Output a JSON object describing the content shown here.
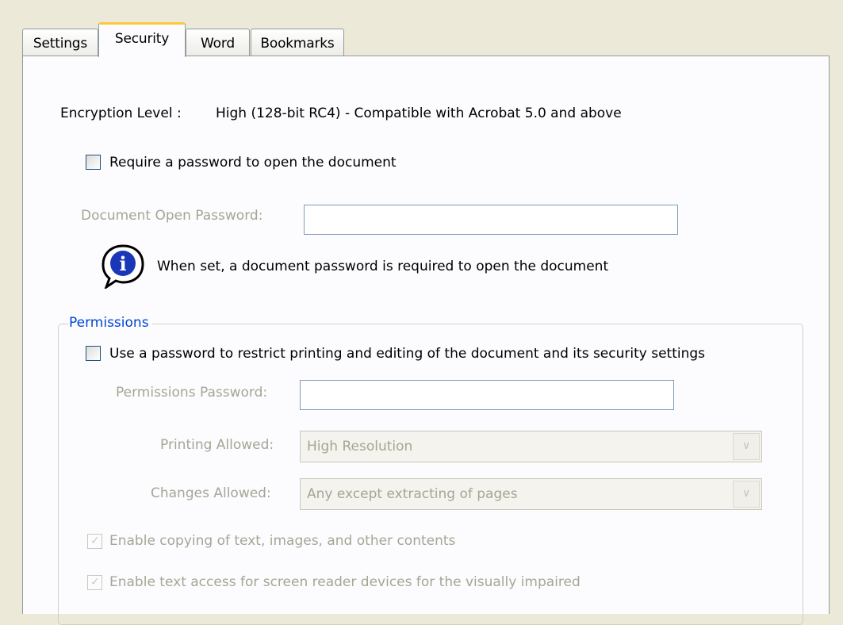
{
  "tabs": [
    {
      "label": "Settings"
    },
    {
      "label": "Security"
    },
    {
      "label": "Word"
    },
    {
      "label": "Bookmarks"
    }
  ],
  "active_tab": "Security",
  "encryption": {
    "label": "Encryption Level :",
    "value": "High (128-bit RC4) - Compatible with Acrobat 5.0 and above"
  },
  "open_password": {
    "checkbox_label": "Require a password to open the document",
    "checked": false,
    "field_label": "Document Open Password:",
    "field_value": "",
    "info_icon": "info-icon",
    "info_text": "When set, a document password is required to open the document"
  },
  "permissions": {
    "group_title": "Permissions",
    "restrict_checkbox_label": "Use a password to restrict printing and editing of the document and its security settings",
    "restrict_checked": false,
    "password_label": "Permissions Password:",
    "password_value": "",
    "printing_label": "Printing Allowed:",
    "printing_value": "High Resolution",
    "changes_label": "Changes Allowed:",
    "changes_value": "Any except extracting of pages",
    "copy_checkbox_label": "Enable copying of text, images, and other contents",
    "copy_checked": true,
    "reader_checkbox_label": "Enable text access for screen reader devices for the visually impaired",
    "reader_checked": true
  },
  "colors": {
    "window_bg": "#ece9d8",
    "panel_bg": "#fcfcfe",
    "active_tab_accent": "#ffc83c",
    "group_title": "#0046d5",
    "disabled_text": "#a6a595"
  }
}
